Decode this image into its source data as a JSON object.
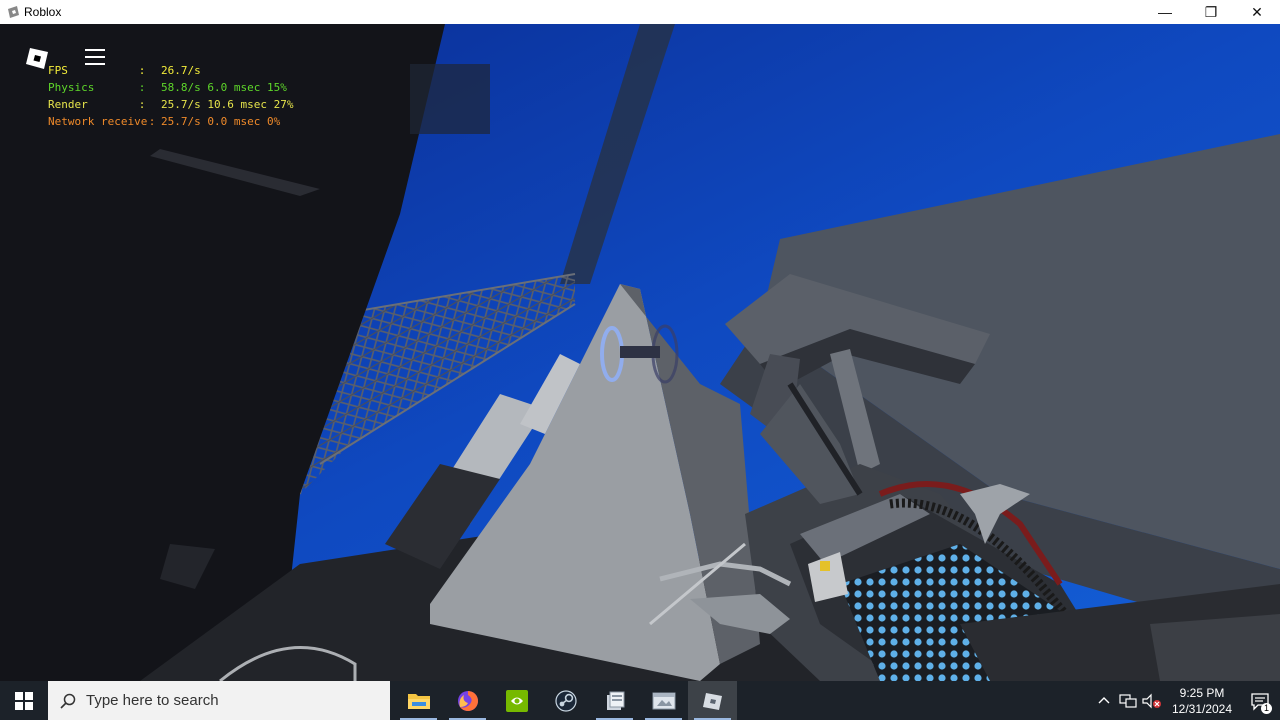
{
  "window": {
    "title": "Roblox",
    "controls": {
      "minimize": "—",
      "restore": "❐",
      "close": "✕"
    }
  },
  "stats": [
    {
      "label": "FPS",
      "colon": ":",
      "value": "26.7/s",
      "color": "#f3ec3a"
    },
    {
      "label": "Physics",
      "colon": ":",
      "value": "58.8/s 6.0 msec 15%",
      "color": "#5ed62a"
    },
    {
      "label": "Render",
      "colon": ":",
      "value": "25.7/s 10.6 msec 27%",
      "color": "#e6e44b"
    },
    {
      "label": "Network receive",
      "colon": ":",
      "value": "25.7/s 0.0 msec 0%",
      "color": "#ef8a2a"
    }
  ],
  "taskbar": {
    "search_placeholder": "Type here to search",
    "pinned": [
      {
        "name": "file-explorer",
        "icon": "folder-icon",
        "open": true
      },
      {
        "name": "firefox",
        "icon": "firefox-icon",
        "open": true
      },
      {
        "name": "nvidia",
        "icon": "nvidia-icon",
        "open": false
      },
      {
        "name": "steam",
        "icon": "steam-icon",
        "open": false
      },
      {
        "name": "app-5",
        "icon": "window-app-icon",
        "open": true
      },
      {
        "name": "app-6",
        "icon": "window-app-icon",
        "open": true
      },
      {
        "name": "roblox",
        "icon": "roblox-icon",
        "open": true,
        "active": true
      }
    ],
    "clock": {
      "time": "9:25 PM",
      "date": "12/31/2024"
    },
    "notification_count": "1"
  }
}
